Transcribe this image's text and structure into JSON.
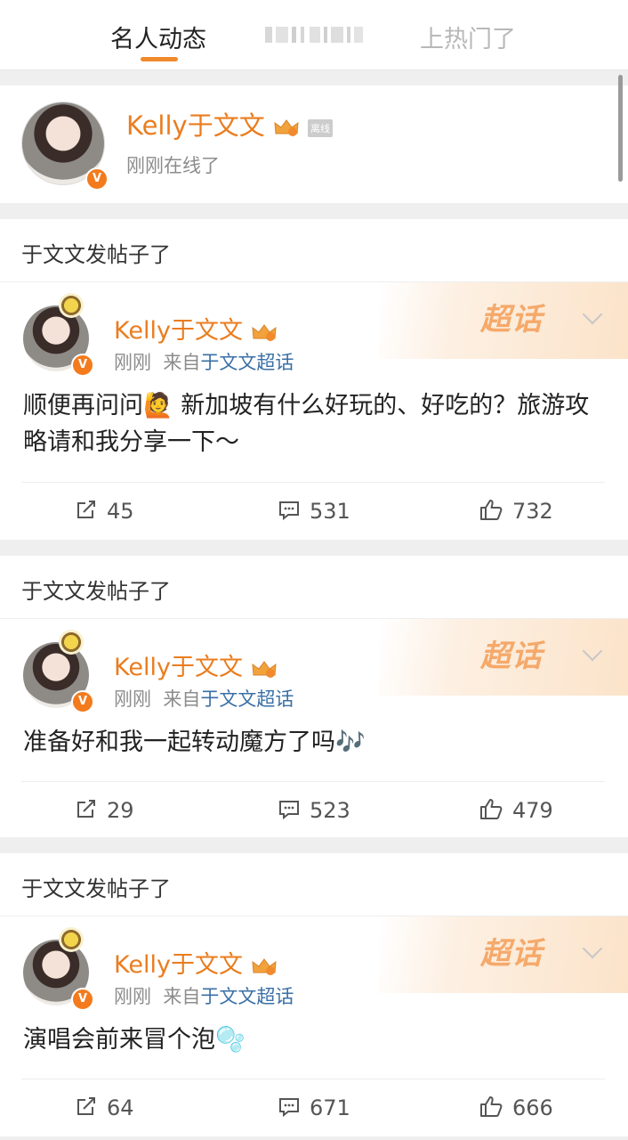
{
  "tabs": [
    {
      "label": "名人动态",
      "active": true
    },
    {
      "label": "",
      "active": false
    },
    {
      "label": "上热门了",
      "active": false
    }
  ],
  "online": {
    "name": "Kelly于文文",
    "status_tag": "离线",
    "status": "刚刚在线了"
  },
  "posts": [
    {
      "header": "于文文发帖子了",
      "author": "Kelly于文文",
      "time": "刚刚",
      "from_label": "来自",
      "source": "于文文超话",
      "supertopic": "超话",
      "content": "顺便再问问🙋 新加坡有什么好玩的、好吃的？旅游攻略请和我分享一下～",
      "reposts": "45",
      "comments": "531",
      "likes": "732"
    },
    {
      "header": "于文文发帖子了",
      "author": "Kelly于文文",
      "time": "刚刚",
      "from_label": "来自",
      "source": "于文文超话",
      "supertopic": "超话",
      "content": "准备好和我一起转动魔方了吗🎶",
      "reposts": "29",
      "comments": "523",
      "likes": "479"
    },
    {
      "header": "于文文发帖子了",
      "author": "Kelly于文文",
      "time": "刚刚",
      "from_label": "来自",
      "source": "于文文超话",
      "supertopic": "超话",
      "content": "演唱会前来冒个泡🫧",
      "reposts": "64",
      "comments": "671",
      "likes": "666"
    }
  ],
  "colors": {
    "accent": "#ea7d1e",
    "link": "#3a6fa6",
    "muted": "#8c8c8c"
  },
  "icons": {
    "repost": "repost-icon",
    "comment": "comment-icon",
    "like": "like-icon",
    "verified": "verified-v-badge",
    "crown": "crown-icon",
    "chevron": "chevron-down-icon"
  }
}
